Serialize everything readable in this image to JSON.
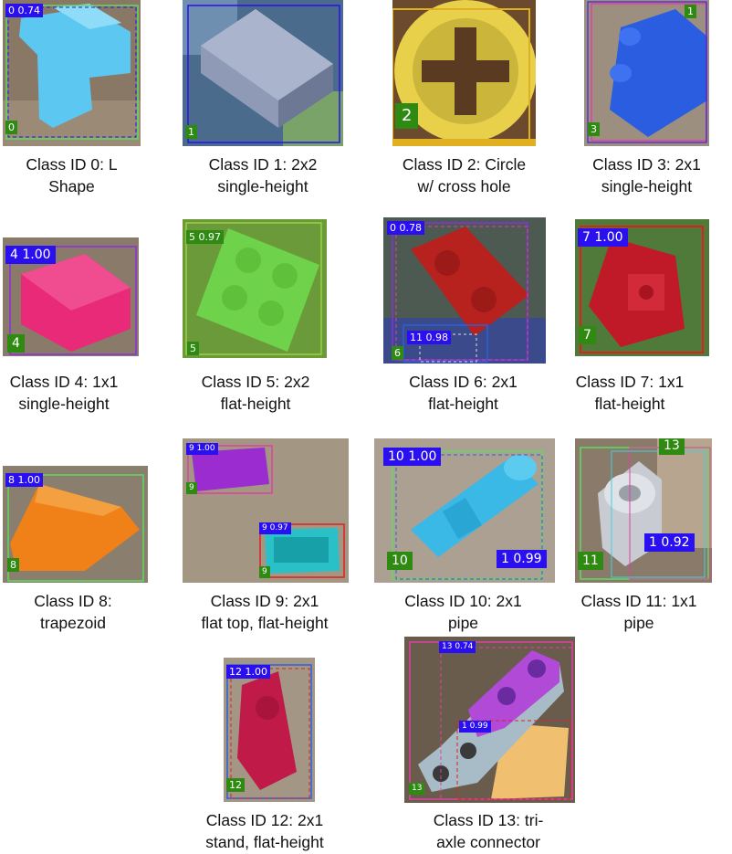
{
  "captions": {
    "c0": [
      "Class ID 0: L",
      "Shape"
    ],
    "c1": [
      "Class ID 1: 2x2",
      "single-height"
    ],
    "c2": [
      "Class ID 2: Circle",
      "w/ cross hole"
    ],
    "c3": [
      "Class ID 3: 2x1",
      "single-height"
    ],
    "c4": [
      "Class ID 4: 1x1",
      "single-height"
    ],
    "c5": [
      "Class ID 5: 2x2",
      "flat-height"
    ],
    "c6": [
      "Class ID 6: 2x1",
      "flat-height"
    ],
    "c7": [
      "Class ID 7: 1x1",
      "flat-height"
    ],
    "c8": [
      "Class ID 8:",
      "trapezoid"
    ],
    "c9": [
      "Class ID 9: 2x1",
      "flat top, flat-height"
    ],
    "c10": [
      "Class ID 10: 2x1",
      "pipe"
    ],
    "c11": [
      "Class ID 11: 1x1",
      "pipe"
    ],
    "c12": [
      "Class ID 12: 2x1",
      "stand, flat-height"
    ],
    "c13": [
      "Class ID 13: tri-",
      "axle connector"
    ]
  },
  "labels": {
    "p0_top": "0 0.74",
    "p0_bot": "0",
    "p1_bot": "1",
    "p2_bot": "2",
    "p3_top": "1",
    "p3_bot": "3",
    "p4_top": "4 1.00",
    "p4_bot": "4",
    "p5_top": "5 0.97",
    "p5_bot": "5",
    "p6_top": "0 0.78",
    "p6_mid": "11 0.98",
    "p6_bot": "6",
    "p7_top": "7 1.00",
    "p7_bot": "7",
    "p8_top": "8 1.00",
    "p8_bot": "8",
    "p9_top1": "9 1.00",
    "p9_bot1": "9",
    "p9_top2": "9 0.97",
    "p9_bot2": "9",
    "p10_top": "10 1.00",
    "p10_right": "1 0.99",
    "p10_bot": "10",
    "p11_top": "13",
    "p11_mid": "1 0.92",
    "p11_bot": "11",
    "p12_top": "12 1.00",
    "p12_bot": "12",
    "p13_top": "13 0.74",
    "p13_mid": "1 0.99",
    "p13_bot": "13"
  },
  "colors": {
    "class_label_bg": "#2a10f0",
    "id_label_bg": "#2f8a12"
  }
}
